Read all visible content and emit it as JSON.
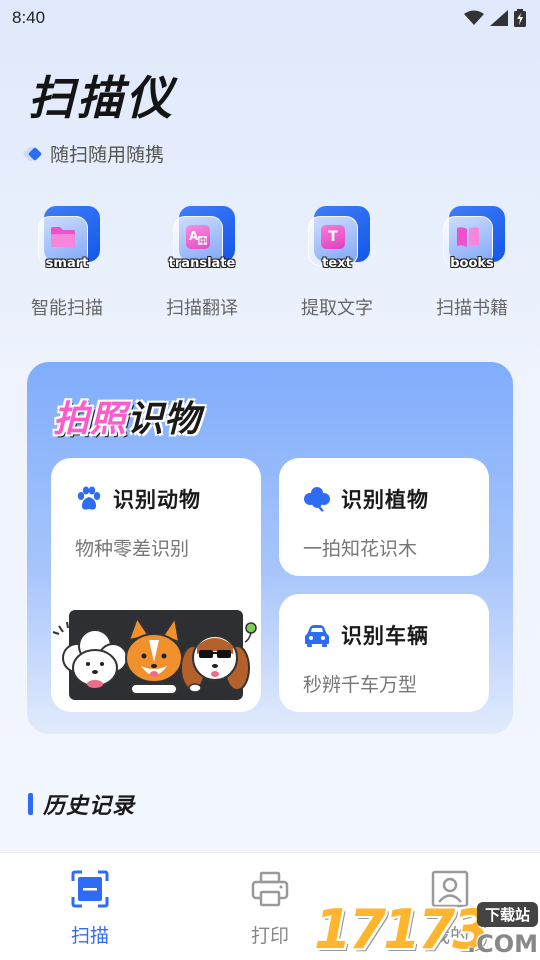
{
  "status": {
    "time": "8:40"
  },
  "header": {
    "title": "扫描仪",
    "slogan": "随扫随用随携"
  },
  "features": [
    {
      "tag": "smart",
      "label": "智能扫描",
      "icon": "folder-icon"
    },
    {
      "tag": "translate",
      "label": "扫描翻译",
      "icon": "translate-icon"
    },
    {
      "tag": "text",
      "label": "提取文字",
      "icon": "text-icon",
      "glyph": "T"
    },
    {
      "tag": "books",
      "label": "扫描书籍",
      "icon": "book-icon"
    }
  ],
  "recognize": {
    "title_highlight": "拍照",
    "title_rest": "识物",
    "animal": {
      "title": "识别动物",
      "subtitle": "物种零差识别"
    },
    "plant": {
      "title": "识别植物",
      "subtitle": "一拍知花识木"
    },
    "car": {
      "title": "识别车辆",
      "subtitle": "秒辨千车万型"
    }
  },
  "history": {
    "title": "历史记录"
  },
  "nav": {
    "scan": "扫描",
    "print": "打印",
    "mine": "我的"
  },
  "watermark": {
    "number": "17173",
    "tag": "下载站",
    "domain": ".COM"
  },
  "colors": {
    "accent": "#2f6cf5",
    "pink": "#ff5ccb"
  }
}
